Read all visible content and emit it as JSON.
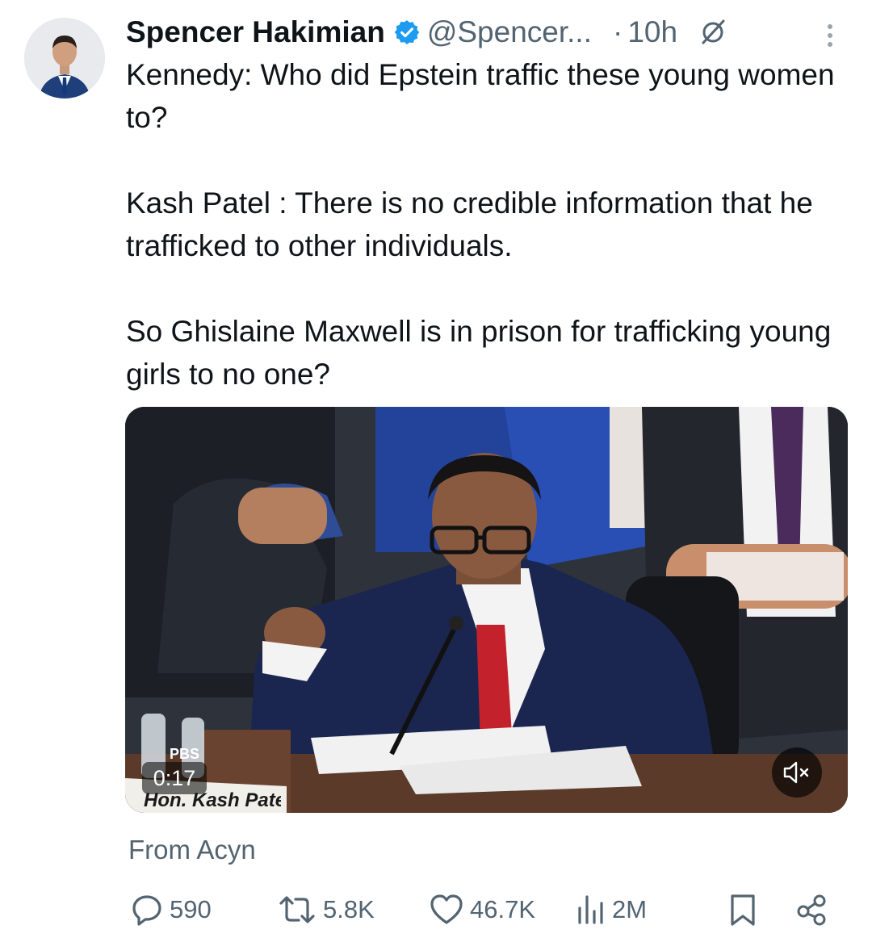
{
  "tweet": {
    "author_name": "Spencer Hakimian",
    "handle": "@Spencer...",
    "separator": "·",
    "time": "10h",
    "text": "Kennedy: Who did Epstein traffic these young women to?\n\nKash Patel : There is no credible information that he trafficked to other individuals.\n\nSo Ghislaine Maxwell is in prison for trafficking young girls to no one?"
  },
  "media": {
    "duration": "0:17",
    "nameplate": "Hon. Kash Patel",
    "network_logo": "PBS"
  },
  "source": "From Acyn",
  "actions": {
    "replies": "590",
    "reposts": "5.8K",
    "likes": "46.7K",
    "views": "2M"
  },
  "icons": [
    "verified-badge-icon",
    "grok-icon",
    "more-icon",
    "mute-icon",
    "reply-icon",
    "repost-icon",
    "like-icon",
    "views-icon",
    "bookmark-icon",
    "share-icon"
  ],
  "colors": {
    "verified": "#1d9bf0",
    "text": "#0f1419",
    "muted": "#536471"
  }
}
